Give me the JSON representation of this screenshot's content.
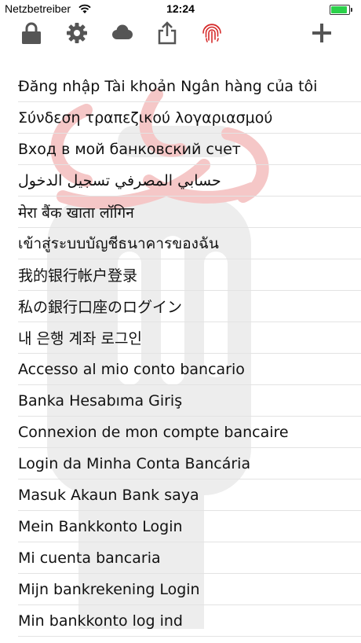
{
  "status": {
    "carrier": "Netzbetreiber",
    "time": "12:24",
    "battery_color": "#2bd14a"
  },
  "toolbar": {
    "icons": [
      "lock-icon",
      "gear-icon",
      "cloud-icon",
      "share-icon",
      "fingerprint-icon",
      "plus-icon"
    ],
    "accent": "#d62b2b"
  },
  "list": {
    "items": [
      "Đăng nhập Tài khoản Ngân hàng của tôi",
      "Σύνδεση τραπεζικού λογαριασμού",
      "Вход в мой банковский счет",
      "حسابي المصرفي تسجيل الدخول",
      "मेरा बैंक खाता लॉगिन",
      "เข้าสู่ระบบบัญชีธนาคารของฉัน",
      "我的银行帐户登录",
      "私の銀行口座のログイン",
      "내 은행 계좌 로그인",
      "Accesso al mio conto bancario",
      "Banka Hesabıma Giriş",
      "Connexion de mon compte bancaire",
      "Login da Minha Conta Bancária",
      "Masuk Akaun Bank saya",
      "Mein Bankkonto Login",
      "Mi cuenta bancaria",
      "Mijn bankrekening Login",
      "Min bankkonto log ind"
    ]
  }
}
